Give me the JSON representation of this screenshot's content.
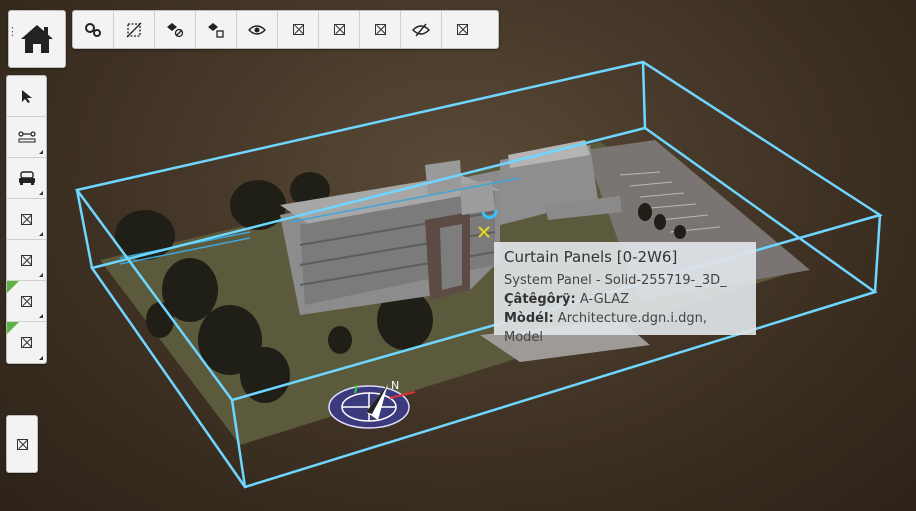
{
  "tooltip": {
    "title": "Curtain Panels [0-2W6]",
    "line1": "System Panel - Solid-255719-_3D_",
    "category_label": "Çâtêgôrÿ:",
    "category_value": "A-GLAZ",
    "model_label": "Mòdél:",
    "model_value": "Architecture.dgn.i.dgn, Model"
  },
  "top_toolbar": [
    "settings-gears-icon",
    "clip-volume-icon",
    "hide-element-icon",
    "isolate-element-icon",
    "eye-icon",
    "placeholder-icon-1",
    "placeholder-icon-2",
    "placeholder-icon-3",
    "eye-hidden-icon",
    "placeholder-icon-4"
  ],
  "left_toolbar": [
    "select-cursor-icon",
    "measure-icon",
    "walk-car-icon",
    "placeholder-icon-a",
    "placeholder-icon-b",
    "placeholder-icon-c",
    "placeholder-icon-d"
  ],
  "colors": {
    "box": "#6fd6ff",
    "ground": "#5a5a3c",
    "building": "#8a8a8a"
  }
}
